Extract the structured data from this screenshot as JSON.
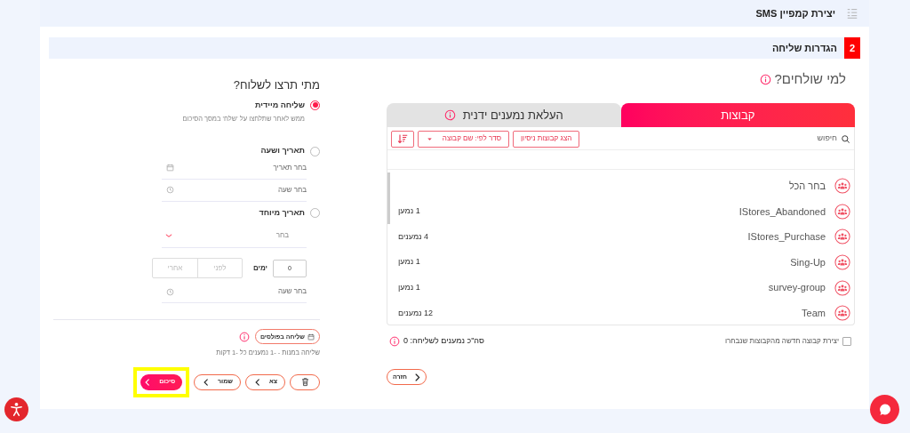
{
  "header": {
    "title": "יצירת קמפיין SMS"
  },
  "step": {
    "number": "2",
    "title": "הגדרות שליחה"
  },
  "recipients": {
    "title": "למי שולחים?",
    "tabs": [
      {
        "label": "קבוצות",
        "selected": true,
        "info": false
      },
      {
        "label": "העלאת נמענים ידנית",
        "selected": false,
        "info": true
      }
    ],
    "search": {
      "placeholder": "חיפוש"
    },
    "show_test_groups": "הצג קבוצות ניסיון",
    "sort_dropdown": "סדר לפי: שם קבוצה",
    "groups": [
      {
        "name": "בחר הכל"
      },
      {
        "name": "IStores_Abandoned",
        "count": "1 נמען"
      },
      {
        "name": "IStores_Purchase",
        "count": "4 נמענים"
      },
      {
        "name": "Sing-Up",
        "count": "1 נמען"
      },
      {
        "name": "survey-group",
        "count": "1 נמען"
      },
      {
        "name": "Team",
        "count": "12 נמענים"
      }
    ],
    "create_group": {
      "label": "יצירת קבוצה חדשה מהקבוצות שנבחרו",
      "checked": false
    },
    "total": "סה\"כ נמענים לשליחה: 0"
  },
  "schedule": {
    "title": "מתי תרצו לשלוח?",
    "options": [
      {
        "kind": "immediate",
        "label": "שליחה מיידית",
        "selected": true,
        "description": "ממש לאחר שתלחצו על 'שלח' במסך הסיכום"
      },
      {
        "kind": "datetime",
        "label": "תאריך ושעה",
        "selected": false,
        "date_placeholder": "בחר תאריך",
        "time_placeholder": "בחר שעה"
      },
      {
        "kind": "special",
        "label": "תאריך מיוחד",
        "selected": false,
        "select_placeholder": "בחר",
        "days_value": "0",
        "days_label": "ימים",
        "before": "לפני",
        "after": "אחרי",
        "time_placeholder": "בחר שעה"
      }
    ],
    "pulse_button": "שליחה בפולסים",
    "pulse_info": "שליחה במנות - -1 נמענים כל -1 דקות"
  },
  "actions": [
    {
      "kind": "delete"
    },
    {
      "kind": "outline",
      "label": "צא"
    },
    {
      "kind": "outline",
      "label": "שמור"
    },
    {
      "kind": "primary",
      "label": "סיכום",
      "highlighted": true
    }
  ],
  "back_button": "חזרה"
}
